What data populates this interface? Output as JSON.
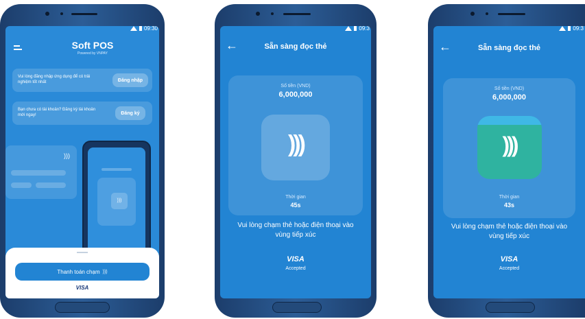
{
  "phone1": {
    "status_time": "09:30",
    "app_title": "Soft POS",
    "app_subtitle": "Powered by VNPAY",
    "login_prompt": "Vui lòng đăng nhập ứng dụng để có trải nghiệm tốt nhất",
    "login_button": "Đăng nhập",
    "register_prompt": "Bạn chưa có tài khoản? Đăng ký tài khoản mới ngay!",
    "register_button": "Đăng ký",
    "pay_button": "Thanh toán chạm",
    "card_brand": "VISA"
  },
  "phone2": {
    "status_time": "09:3",
    "title": "Sẵn sàng đọc thẻ",
    "amount_label": "Số tiền (VND)",
    "amount": "6,000,000",
    "time_label": "Thời gian",
    "time_value": "45s",
    "instruction": "Vui lòng chạm thẻ hoặc điện thoại vào vùng tiếp xúc",
    "card_brand": "VISA",
    "accepted": "Accepted"
  },
  "phone3": {
    "status_time": "09:3",
    "title": "Sẵn sàng đọc thẻ",
    "amount_label": "Số tiền (VND)",
    "amount": "6,000,000",
    "time_label": "Thời gian",
    "time_value": "43s",
    "instruction": "Vui lòng chạm thẻ hoặc điện thoại vào vùng tiếp xúc",
    "card_brand": "VISA",
    "accepted": "Accepted"
  },
  "colors": {
    "screen_blue": "#2284d3",
    "nfc_teal": "#2fb3a0",
    "frame": "#2c5d96"
  },
  "icons": [
    "menu-icon",
    "back-arrow-icon",
    "contactless-icon",
    "signal-icon",
    "battery-icon"
  ]
}
